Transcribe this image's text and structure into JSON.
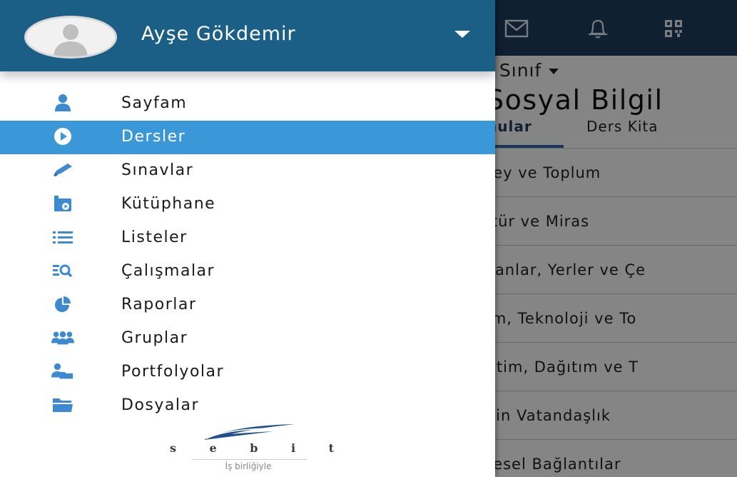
{
  "colors": {
    "header_blue": "#1c5f86",
    "active_blue": "#3a98d9",
    "icon_blue": "#3d8ad0",
    "app_topbar": "#1d3f63"
  },
  "drawer": {
    "user": {
      "name": "Ayşe Gökdemir",
      "avatar_icon": "user-avatar-icon",
      "menu_icon": "caret-down-icon"
    },
    "menu_items": [
      {
        "label": "Sayfam",
        "icon": "user-icon",
        "active": false
      },
      {
        "label": "Dersler",
        "icon": "play-circle-icon",
        "active": true
      },
      {
        "label": "Sınavlar",
        "icon": "pencil-icon",
        "active": false
      },
      {
        "label": "Kütüphane",
        "icon": "video-library-icon",
        "active": false
      },
      {
        "label": "Listeler",
        "icon": "list-icon",
        "active": false
      },
      {
        "label": "Çalışmalar",
        "icon": "list-search-icon",
        "active": false
      },
      {
        "label": "Raporlar",
        "icon": "pie-chart-icon",
        "active": false
      },
      {
        "label": "Gruplar",
        "icon": "group-icon",
        "active": false
      },
      {
        "label": "Portfolyolar",
        "icon": "user-folder-icon",
        "active": false
      },
      {
        "label": "Dosyalar",
        "icon": "folder-icon",
        "active": false
      }
    ],
    "brand": {
      "letters": [
        "s",
        "e",
        "b",
        "i",
        "t"
      ],
      "tagline": "İş birliğiyle"
    }
  },
  "app": {
    "toolbar_icons": [
      "mail-icon",
      "bell-icon",
      "qr-code-icon"
    ],
    "class_selector": ". Sınıf",
    "course_title": "Sosyal Bilgil",
    "tabs": [
      "nular",
      "Ders Kita"
    ],
    "units": [
      "rey ve Toplum",
      "ltür ve Miras",
      "sanlar, Yerler ve Çe",
      "im, Teknoloji ve To",
      "etim, Dağıtım ve T",
      "kin Vatandaşlık",
      "resel Bağlantılar"
    ]
  }
}
